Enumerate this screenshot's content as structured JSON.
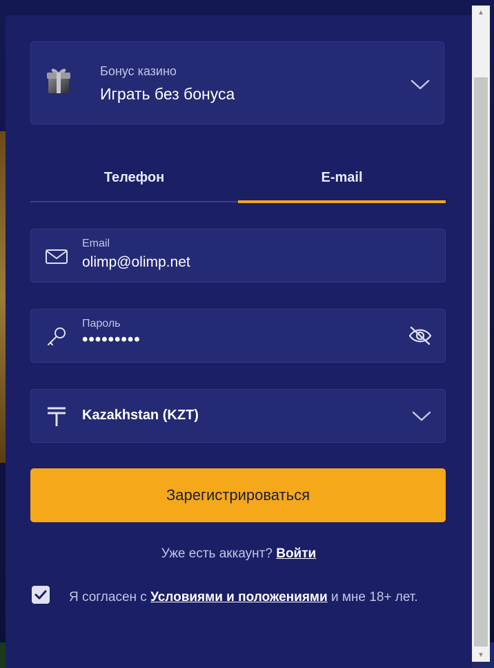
{
  "bonus": {
    "caption": "Бонус казино",
    "value": "Играть без бонуса",
    "icon": "gift-icon"
  },
  "tabs": [
    {
      "label": "Телефон",
      "active": false
    },
    {
      "label": "E-mail",
      "active": true
    }
  ],
  "form": {
    "email": {
      "label": "Email",
      "value": "olimp@olimp.net",
      "icon": "mail-icon"
    },
    "password": {
      "label": "Пароль",
      "value": "•••••••••",
      "icon": "key-icon",
      "toggle_icon": "eye-off-icon"
    },
    "currency": {
      "value": "Kazakhstan (KZT)",
      "icon": "tenge-icon"
    }
  },
  "register_button": "Зарегистрироваться",
  "login": {
    "prompt": "Уже есть аккаунт?",
    "link": "Войти"
  },
  "agreement": {
    "checked": true,
    "prefix": "Я согласен с",
    "link": "Условиями и положениями",
    "suffix": "и мне 18+ лет."
  },
  "colors": {
    "panel": "#1a1f66",
    "field": "#242a73",
    "accent": "#f5a81a"
  }
}
